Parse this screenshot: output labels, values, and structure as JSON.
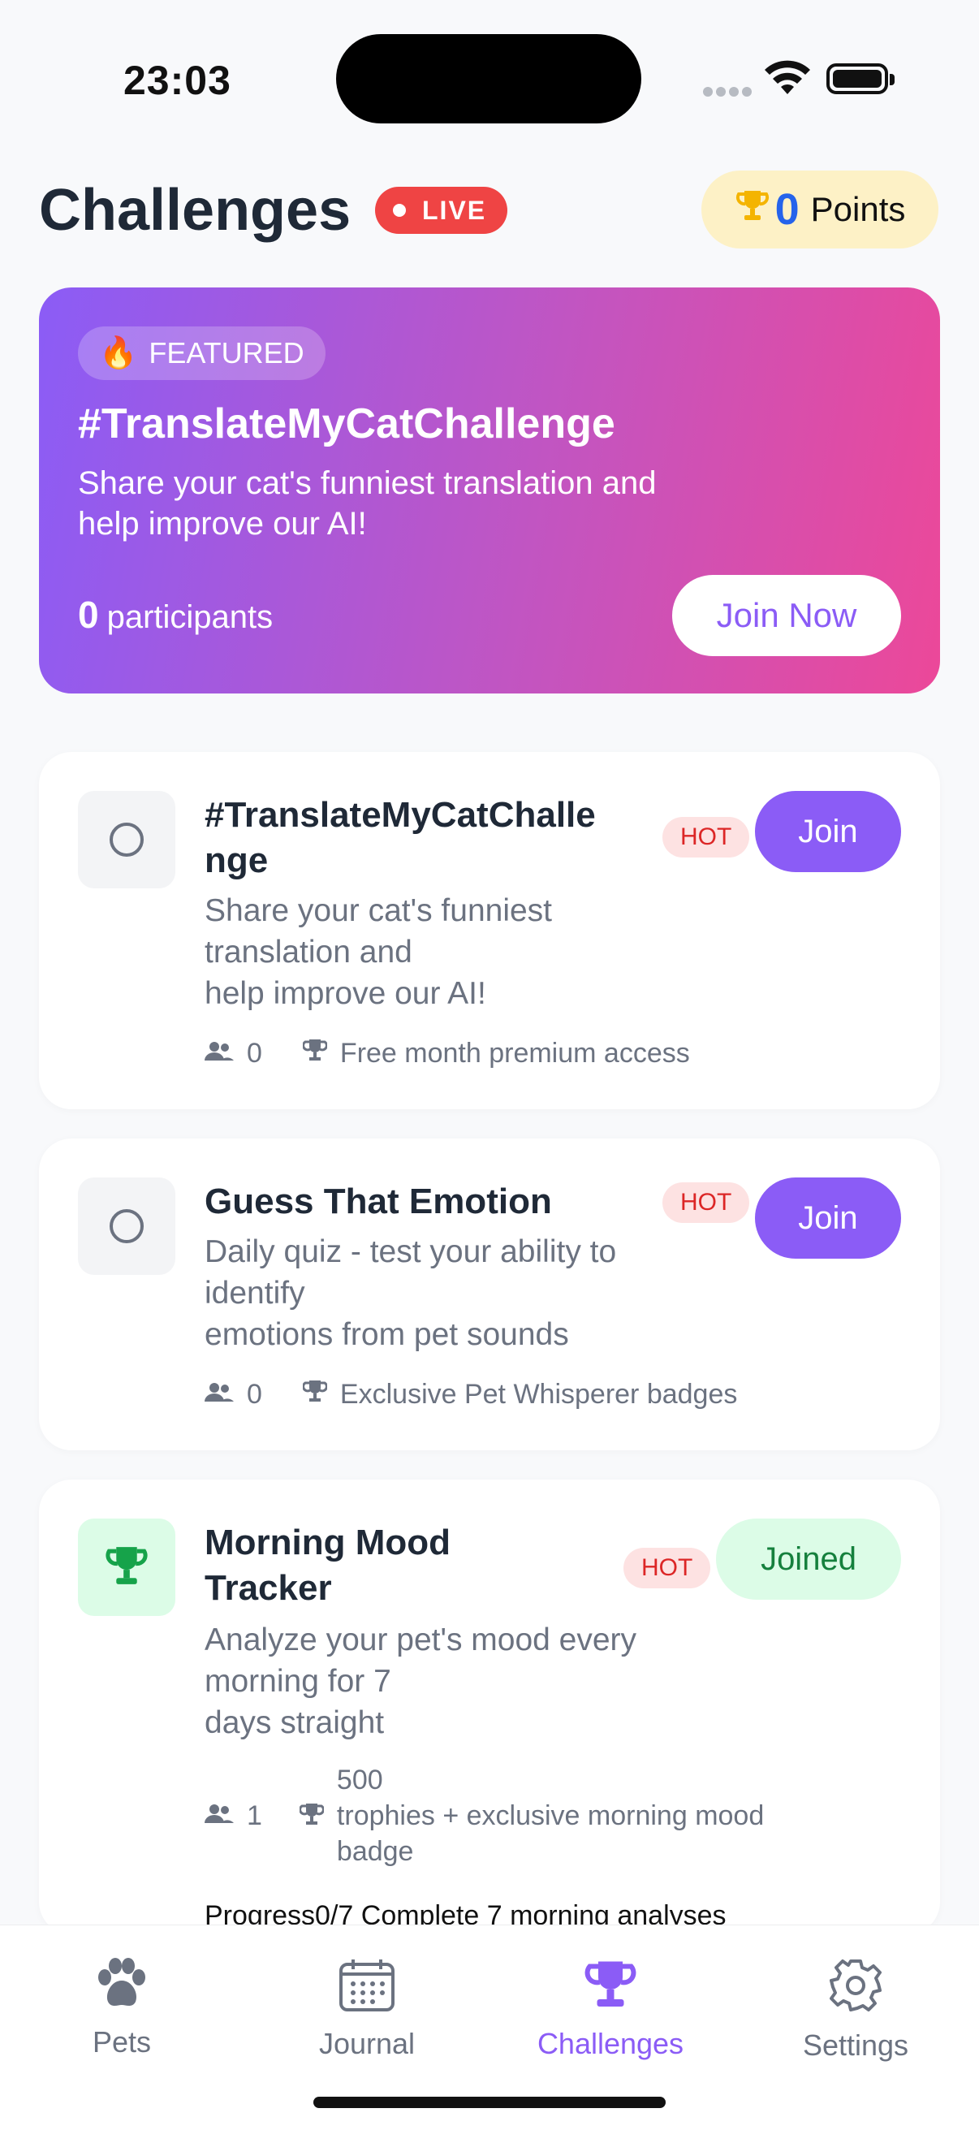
{
  "status_bar": {
    "time": "23:03"
  },
  "header": {
    "title": "Challenges",
    "live_label": "LIVE",
    "points_value": "0",
    "points_label": "Points"
  },
  "featured": {
    "badge": "FEATURED",
    "title": "#TranslateMyCatChallenge",
    "description": "Share your cat's funniest translation and\n  help improve our AI!",
    "participants_count": "0",
    "participants_label": "participants",
    "cta": "Join Now"
  },
  "challenges": [
    {
      "title": "#TranslateMyCatChalle\nnge",
      "badge": "HOT",
      "action": "Join",
      "description": "Share your cat's funniest\ntranslation and\n  help improve our AI!",
      "participants": "0",
      "prize": "Free month premium access"
    },
    {
      "title": "Guess That Emotion",
      "badge": "HOT",
      "action": "Join",
      "description": "Daily quiz - test your ability to\nidentify\n  emotions from pet sounds",
      "participants": "0",
      "prize": "Exclusive Pet Whisperer badges"
    },
    {
      "title": "Morning Mood\nTracker",
      "badge": "HOT",
      "action": "Joined",
      "description": "Analyze your pet's mood every\nmorning for 7\n  days straight",
      "participants": "1",
      "prize": "500\n  trophies + exclusive morning mood\nbadge",
      "progress_text": "Progress0/7 Complete 7 morning analyses"
    }
  ],
  "tabs": [
    {
      "label": "Pets",
      "icon": "paw-icon"
    },
    {
      "label": "Journal",
      "icon": "calendar-icon"
    },
    {
      "label": "Challenges",
      "icon": "trophy-icon",
      "active": true
    },
    {
      "label": "Settings",
      "icon": "gear-icon"
    }
  ],
  "colors": {
    "accent": "#8B5CF6",
    "live_red": "#EF4444",
    "points_blue": "#2563EB",
    "joined_green": "#15803D"
  }
}
